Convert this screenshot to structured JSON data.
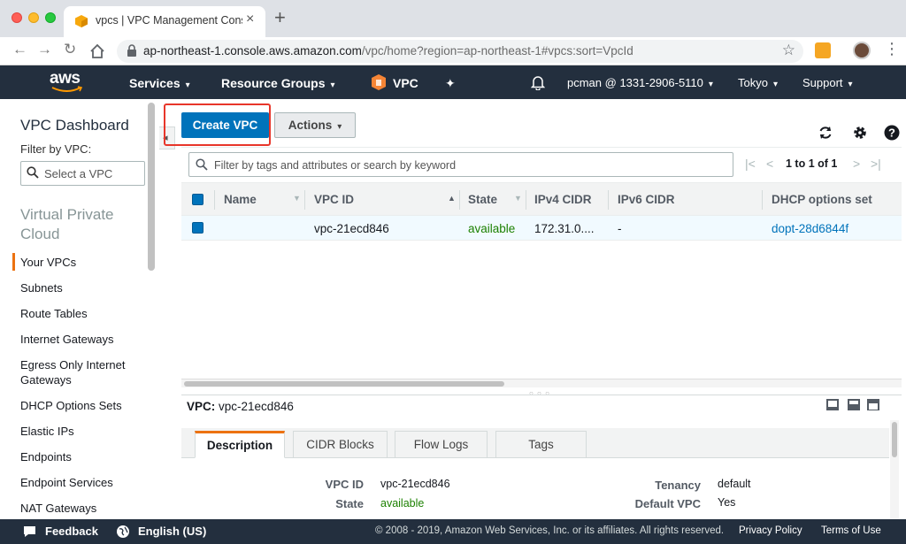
{
  "browser": {
    "tab_title": "vpcs | VPC Management Conso",
    "url_host": "ap-northeast-1.console.aws.amazon.com",
    "url_path": "/vpc/home?region=ap-northeast-1#vpcs:sort=VpcId"
  },
  "aws_nav": {
    "logo": "aws",
    "services": "Services",
    "resource_groups": "Resource Groups",
    "vpc": "VPC",
    "account": "pcman @ 1331-2906-5110",
    "region": "Tokyo",
    "support": "Support"
  },
  "sidebar": {
    "title": "VPC Dashboard",
    "filter_label": "Filter by VPC:",
    "select_placeholder": "Select a VPC",
    "section": "Virtual Private Cloud",
    "items": [
      {
        "label": "Your VPCs",
        "active": true
      },
      {
        "label": "Subnets"
      },
      {
        "label": "Route Tables"
      },
      {
        "label": "Internet Gateways"
      },
      {
        "label": "Egress Only Internet Gateways"
      },
      {
        "label": "DHCP Options Sets"
      },
      {
        "label": "Elastic IPs"
      },
      {
        "label": "Endpoints"
      },
      {
        "label": "Endpoint Services"
      },
      {
        "label": "NAT Gateways"
      }
    ]
  },
  "toolbar": {
    "create_label": "Create VPC",
    "actions_label": "Actions"
  },
  "table": {
    "search_placeholder": "Filter by tags and attributes or search by keyword",
    "pager_text": "1 to 1 of 1",
    "columns": [
      "Name",
      "VPC ID",
      "State",
      "IPv4 CIDR",
      "IPv6 CIDR",
      "DHCP options set"
    ],
    "rows": [
      {
        "name": "",
        "vpc_id": "vpc-21ecd846",
        "state": "available",
        "ipv4": "172.31.0....",
        "ipv6": "-",
        "dhcp": "dopt-28d6844f"
      }
    ]
  },
  "details": {
    "title_label": "VPC:",
    "title_value": "vpc-21ecd846",
    "tabs": [
      "Description",
      "CIDR Blocks",
      "Flow Logs",
      "Tags"
    ],
    "fields": {
      "vpc_id_label": "VPC ID",
      "vpc_id": "vpc-21ecd846",
      "state_label": "State",
      "state": "available",
      "tenancy_label": "Tenancy",
      "tenancy": "default",
      "default_vpc_label": "Default VPC",
      "default_vpc": "Yes"
    }
  },
  "footer": {
    "feedback": "Feedback",
    "language": "English (US)",
    "copyright": "© 2008 - 2019, Amazon Web Services, Inc. or its affiliates. All rights reserved.",
    "privacy": "Privacy Policy",
    "terms": "Terms of Use"
  },
  "colors": {
    "aws_dark": "#232f3e",
    "primary_blue": "#0073bb",
    "accent_orange": "#ec7211",
    "available_green": "#1d8102",
    "highlight_red": "#e8362a"
  }
}
